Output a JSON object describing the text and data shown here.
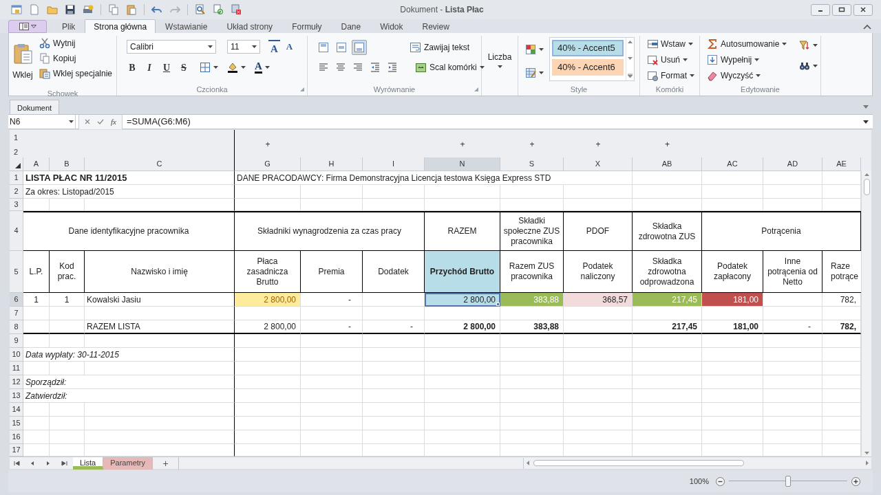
{
  "window": {
    "title": "Dokument - **Lista Płac**"
  },
  "ribbon_tabs": [
    {
      "label": "Plik",
      "selected": false
    },
    {
      "label": "Strona główna",
      "selected": true
    },
    {
      "label": "Wstawianie",
      "selected": false
    },
    {
      "label": "Układ strony",
      "selected": false
    },
    {
      "label": "Formuły",
      "selected": false
    },
    {
      "label": "Dane",
      "selected": false
    },
    {
      "label": "Widok",
      "selected": false
    },
    {
      "label": "Review",
      "selected": false
    }
  ],
  "ribbon": {
    "clipboard": {
      "title": "Schowek",
      "paste": "Wklej",
      "items": [
        "Wytnij",
        "Kopiuj",
        "Wklej specjalnie"
      ]
    },
    "font": {
      "title": "Czcionka",
      "family": "Calibri",
      "size": "11",
      "grow": "A",
      "shrink": "A",
      "styles": [
        {
          "label": "B",
          "kind": "bold"
        },
        {
          "label": "I",
          "kind": "italic"
        },
        {
          "label": "U",
          "kind": "underline"
        },
        {
          "label": "S",
          "kind": "strike"
        }
      ],
      "color_label": "A"
    },
    "alignment": {
      "title": "Wyrównanie",
      "vertical": [
        {
          "selected": false
        },
        {
          "selected": false
        },
        {
          "selected": true
        }
      ],
      "wrap": "Zawijaj tekst",
      "merge": "Scal komórki"
    },
    "number": {
      "label": "Liczba"
    },
    "styles": {
      "title": "Style",
      "gallery": [
        {
          "label": "40% - Accent5",
          "color": "#b7dee8",
          "selected": true
        },
        {
          "label": "40% - Accent6",
          "color": "#fcd5b4",
          "selected": false
        }
      ]
    },
    "cells": {
      "title": "Komórki",
      "items": [
        "Wstaw",
        "Usuń",
        "Format"
      ]
    },
    "editing": {
      "title": "Edytowanie",
      "items": [
        "Autosumowanie",
        "Wypełnij",
        "Wyczyść"
      ]
    }
  },
  "document_tab": "Dokument",
  "formula_bar": {
    "name_box": "N6",
    "fx": "fx",
    "formula": "=SUMA(G6:M6)"
  },
  "outline": {
    "levels": [
      "1",
      "2"
    ]
  },
  "sheet": {
    "columns": [
      {
        "label": "A",
        "selected": false,
        "frozen": false
      },
      {
        "label": "B",
        "selected": false,
        "frozen": false
      },
      {
        "label": "C",
        "selected": false,
        "frozen": true
      },
      {
        "label": "G",
        "selected": false,
        "frozen": false,
        "expand": "+"
      },
      {
        "label": "H",
        "selected": false,
        "frozen": false
      },
      {
        "label": "I",
        "selected": false,
        "frozen": false
      },
      {
        "label": "N",
        "selected": true,
        "frozen": false,
        "expand": "+"
      },
      {
        "label": "S",
        "selected": false,
        "frozen": false,
        "expand": "+"
      },
      {
        "label": "X",
        "selected": false,
        "frozen": false,
        "expand": "+"
      },
      {
        "label": "AB",
        "selected": false,
        "frozen": false,
        "expand": "+"
      },
      {
        "label": "AC",
        "selected": false,
        "frozen": false
      },
      {
        "label": "AD",
        "selected": false,
        "frozen": false
      },
      {
        "label": "AE",
        "selected": false,
        "frozen": false
      }
    ],
    "rows": [
      {
        "label": "1",
        "selected": false,
        "kind": "plain",
        "cells": [
          {
            "text": "LISTA PŁAC NR 11/2015",
            "kind": "title"
          },
          {
            "kind": "merged"
          },
          {
            "kind": "merged"
          },
          {
            "text": "DANE PRACODAWCY: Firma Demonstracyjna Licencja testowa Księga Express STD",
            "kind": "text"
          },
          {
            "kind": "merged"
          },
          {
            "kind": "merged"
          },
          {
            "kind": "merged"
          },
          {
            "kind": "merged"
          },
          {
            "kind": "merged"
          },
          {
            "kind": "empty"
          },
          {
            "kind": "empty"
          },
          {
            "kind": "empty"
          },
          {
            "kind": "empty"
          }
        ]
      },
      {
        "label": "2",
        "selected": false,
        "kind": "plain",
        "cells": [
          {
            "text": "Za okres: Listopad/2015",
            "kind": "text"
          },
          {
            "kind": "merged"
          },
          {
            "kind": "merged"
          },
          {
            "kind": "empty"
          },
          {
            "kind": "empty"
          },
          {
            "kind": "empty"
          },
          {
            "kind": "empty"
          },
          {
            "kind": "empty"
          },
          {
            "kind": "empty"
          },
          {
            "kind": "empty"
          },
          {
            "kind": "empty"
          },
          {
            "kind": "empty"
          },
          {
            "kind": "empty"
          }
        ]
      },
      {
        "label": "3",
        "selected": false,
        "kind": "plain"
      },
      {
        "label": "4",
        "selected": false,
        "kind": "band",
        "cells": [
          {
            "text": "Dane identyfikacyjne pracownika",
            "kind": "header"
          },
          {
            "kind": "merged"
          },
          {
            "kind": "merged"
          },
          {
            "text": "Składniki wynagrodzenia za czas pracy",
            "kind": "header"
          },
          {
            "kind": "merged"
          },
          {
            "kind": "merged"
          },
          {
            "text": "RAZEM",
            "kind": "header"
          },
          {
            "text": "Składki społeczne ZUS pracownika",
            "kind": "header"
          },
          {
            "text": "PDOF",
            "kind": "header"
          },
          {
            "text": "Składka zdrowotna ZUS",
            "kind": "header"
          },
          {
            "text": "Potrącenia",
            "kind": "header"
          },
          {
            "kind": "merged"
          },
          {
            "kind": "merged"
          }
        ]
      },
      {
        "label": "5",
        "selected": false,
        "kind": "plain",
        "cells": [
          {
            "text": "L.P.",
            "kind": "header"
          },
          {
            "text": "Kod prac.",
            "kind": "header"
          },
          {
            "text": "Nazwisko i imię",
            "kind": "header"
          },
          {
            "text": "Płaca zasadnicza Brutto",
            "kind": "header"
          },
          {
            "text": "Premia",
            "kind": "header"
          },
          {
            "text": "Dodatek",
            "kind": "header"
          },
          {
            "text": "Przychód Brutto",
            "kind": "header-bold",
            "color": "#b7dee8"
          },
          {
            "text": "Razem ZUS pracownika",
            "kind": "header"
          },
          {
            "text": "Podatek naliczony",
            "kind": "header"
          },
          {
            "text": "Składka zdrowotna odprowadzona",
            "kind": "header"
          },
          {
            "text": "Podatek zapłacony",
            "kind": "header"
          },
          {
            "text": "Inne potrącenia od Netto",
            "kind": "header"
          },
          {
            "text": "Raze potrące",
            "kind": "header-cut"
          }
        ]
      },
      {
        "label": "6",
        "selected": true,
        "kind": "plain",
        "cells": [
          {
            "text": "1",
            "kind": "center"
          },
          {
            "text": "1",
            "kind": "center"
          },
          {
            "text": "Kowalski Jasiu",
            "kind": "text"
          },
          {
            "text": "2 800,00",
            "kind": "neutral",
            "color": "#ffeb9c"
          },
          {
            "text": "-",
            "kind": "dash"
          },
          {
            "kind": "empty"
          },
          {
            "text": "2 800,00",
            "kind": "number",
            "color": "#b7dee8"
          },
          {
            "text": "383,88",
            "kind": "light",
            "color": "#9bbb59"
          },
          {
            "text": "368,57",
            "kind": "number",
            "color": "#f2dcdb"
          },
          {
            "text": "217,45",
            "kind": "light",
            "color": "#9bbb59"
          },
          {
            "text": "181,00",
            "kind": "light",
            "color": "#c0504d"
          },
          {
            "kind": "empty"
          },
          {
            "text": "782,",
            "kind": "number"
          }
        ]
      },
      {
        "label": "7",
        "selected": false,
        "kind": "plain"
      },
      {
        "label": "8",
        "selected": false,
        "kind": "total",
        "cells": [
          {
            "kind": "empty"
          },
          {
            "kind": "empty"
          },
          {
            "text": "RAZEM LISTA",
            "kind": "text"
          },
          {
            "text": "2 800,00",
            "kind": "number"
          },
          {
            "text": "-",
            "kind": "dash"
          },
          {
            "text": "-",
            "kind": "dash"
          },
          {
            "text": "2 800,00",
            "kind": "number-bold"
          },
          {
            "text": "383,88",
            "kind": "number-bold"
          },
          {
            "kind": "empty"
          },
          {
            "text": "217,45",
            "kind": "number-bold"
          },
          {
            "text": "181,00",
            "kind": "number-bold"
          },
          {
            "text": "-",
            "kind": "dash"
          },
          {
            "text": "782,",
            "kind": "number-bold"
          }
        ]
      },
      {
        "label": "9",
        "selected": false,
        "kind": "plain"
      },
      {
        "label": "10",
        "selected": false,
        "kind": "plain",
        "cells": [
          {
            "text": "Data wypłaty: 30-11-2015",
            "kind": "italic"
          },
          {
            "kind": "merged"
          },
          {
            "kind": "merged"
          }
        ]
      },
      {
        "label": "11",
        "selected": false,
        "kind": "plain"
      },
      {
        "label": "12",
        "selected": false,
        "kind": "plain",
        "cells": [
          {
            "text": "Sporządził:",
            "kind": "italic"
          },
          {
            "kind": "merged"
          },
          {
            "kind": "merged"
          }
        ]
      },
      {
        "label": "13",
        "selected": false,
        "kind": "plain",
        "cells": [
          {
            "text": "Zatwierdził:",
            "kind": "italic"
          },
          {
            "kind": "merged"
          },
          {
            "kind": "merged"
          }
        ]
      },
      {
        "label": "14",
        "selected": false,
        "kind": "plain"
      },
      {
        "label": "15",
        "selected": false,
        "kind": "plain"
      },
      {
        "label": "16",
        "selected": false,
        "kind": "plain"
      },
      {
        "label": "17",
        "selected": false,
        "kind": "plain"
      }
    ]
  },
  "sheet_tabs": [
    {
      "label": "Lista",
      "selected": true,
      "color": "#9bbb59"
    },
    {
      "label": "Parametry",
      "selected": false,
      "color": "#e6b9b8"
    }
  ],
  "add_sheet": "+",
  "status_bar": {
    "zoom": "100%",
    "level": 0.5
  }
}
